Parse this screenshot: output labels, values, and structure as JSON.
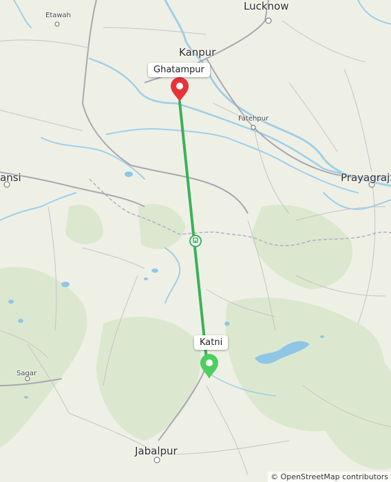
{
  "cities": {
    "lucknow": "Lucknow",
    "kanpur": "Kanpur",
    "etawah": "Etawah",
    "fatehpur": "Fatehpur",
    "prayagraj": "Prayagraj",
    "jhansi": "ansi",
    "sagar": "Sagar",
    "jabalpur": "Jabalpur"
  },
  "route": {
    "start_label": "Ghatampur",
    "end_label": "Katni",
    "line_color": "#3cb05a",
    "start_marker_color": "#e8333a",
    "end_marker_color": "#4ccf5e",
    "midpoint_icon": "train-icon"
  },
  "attribution": "© OpenStreetMap contributors"
}
